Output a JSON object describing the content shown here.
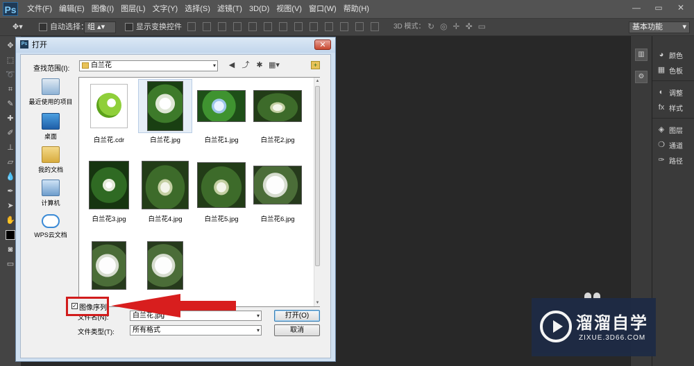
{
  "app": {
    "logo": "Ps",
    "menus": [
      "文件(F)",
      "编辑(E)",
      "图像(I)",
      "图层(L)",
      "文字(Y)",
      "选择(S)",
      "滤镜(T)",
      "3D(D)",
      "视图(V)",
      "窗口(W)",
      "帮助(H)"
    ],
    "window_controls": [
      "—",
      "▭",
      "✕"
    ]
  },
  "options_bar": {
    "auto_select_label": "自动选择：",
    "auto_select_value": "组",
    "show_transform_label": "显示变换控件",
    "mode3d_label": "3D 模式：",
    "workspace": "基本功能"
  },
  "right_panels": {
    "items": [
      "颜色",
      "色板",
      "调整",
      "样式",
      "图层",
      "通道",
      "路径"
    ]
  },
  "dialog": {
    "title": "打开",
    "look_in_label": "查找范围(I):",
    "look_in_value": "白兰花",
    "places": [
      "最近使用的项目",
      "桌面",
      "我的文档",
      "计算机",
      "WPS云文档"
    ],
    "files": [
      {
        "name": "白兰花.cdr"
      },
      {
        "name": "白兰花.jpg"
      },
      {
        "name": "白兰花1.jpg"
      },
      {
        "name": "白兰花2.jpg"
      },
      {
        "name": "白兰花3.jpg"
      },
      {
        "name": "白兰花4.jpg"
      },
      {
        "name": "白兰花5.jpg"
      },
      {
        "name": "白兰花6.jpg"
      },
      {
        "name": ""
      },
      {
        "name": ""
      }
    ],
    "file_name_label": "文件名(N):",
    "file_name_value": "白兰花.jpg",
    "file_type_label": "文件类型(T):",
    "file_type_value": "所有格式",
    "open_button": "打开(O)",
    "cancel_button": "取消",
    "image_sequence_label": "图像序列"
  },
  "watermark": {
    "title": "溜溜自学",
    "url": "ZIXUE.3D66.COM"
  }
}
